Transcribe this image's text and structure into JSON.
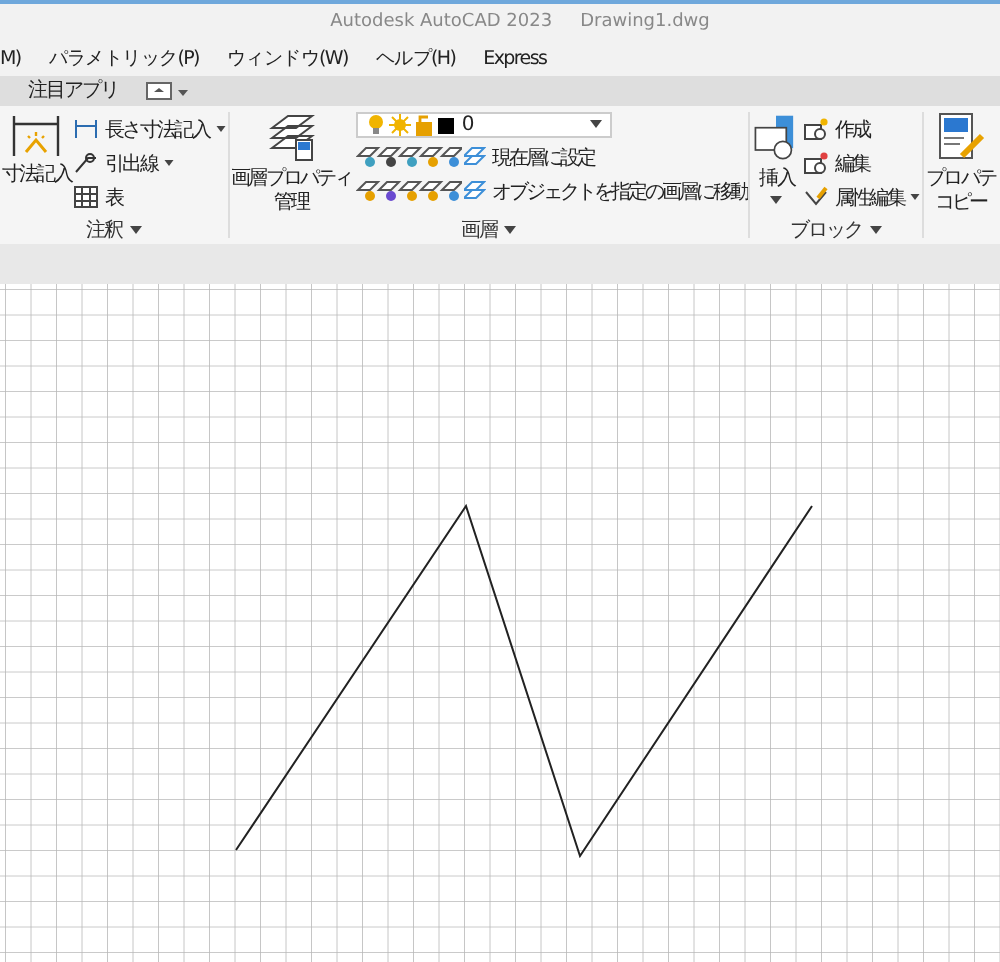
{
  "title_bar": {
    "app": "Autodesk AutoCAD 2023",
    "document": "Drawing1.dwg"
  },
  "menu": [
    "M)",
    "パラメトリック(P)",
    "ウィンドウ(W)",
    "ヘルプ(H)",
    "Express"
  ],
  "ribbon_tabs": [
    {
      "label": "注目アプリ",
      "selected": false
    }
  ],
  "panels": [
    {
      "title": "注釈",
      "large": [
        "寸法記入"
      ],
      "large_dropdown": false,
      "tools": [
        {
          "label": "長さ寸法記入",
          "dropdown": true
        },
        {
          "label": "引出線",
          "dropdown": true
        },
        {
          "label": "表",
          "dropdown": false
        }
      ]
    },
    {
      "title": "画層",
      "large": [
        "画層プロパティ",
        "管理"
      ],
      "large_dropdown": false,
      "layer": {
        "value": "0"
      },
      "tools": [
        {
          "label": "現在層に設定",
          "dropdown": false
        },
        {
          "label": "オブジェクトを指定の画層に移動",
          "dropdown": false
        }
      ]
    },
    {
      "title": "ブロック",
      "large": [
        "挿入"
      ],
      "large_dropdown": true,
      "tools": [
        {
          "label": "作成",
          "dropdown": false
        },
        {
          "label": "編集",
          "dropdown": false
        },
        {
          "label": "属性編集",
          "dropdown": true
        }
      ]
    },
    {
      "large": [
        "プロパテ",
        "コピー"
      ],
      "large_dropdown": false
    }
  ]
}
